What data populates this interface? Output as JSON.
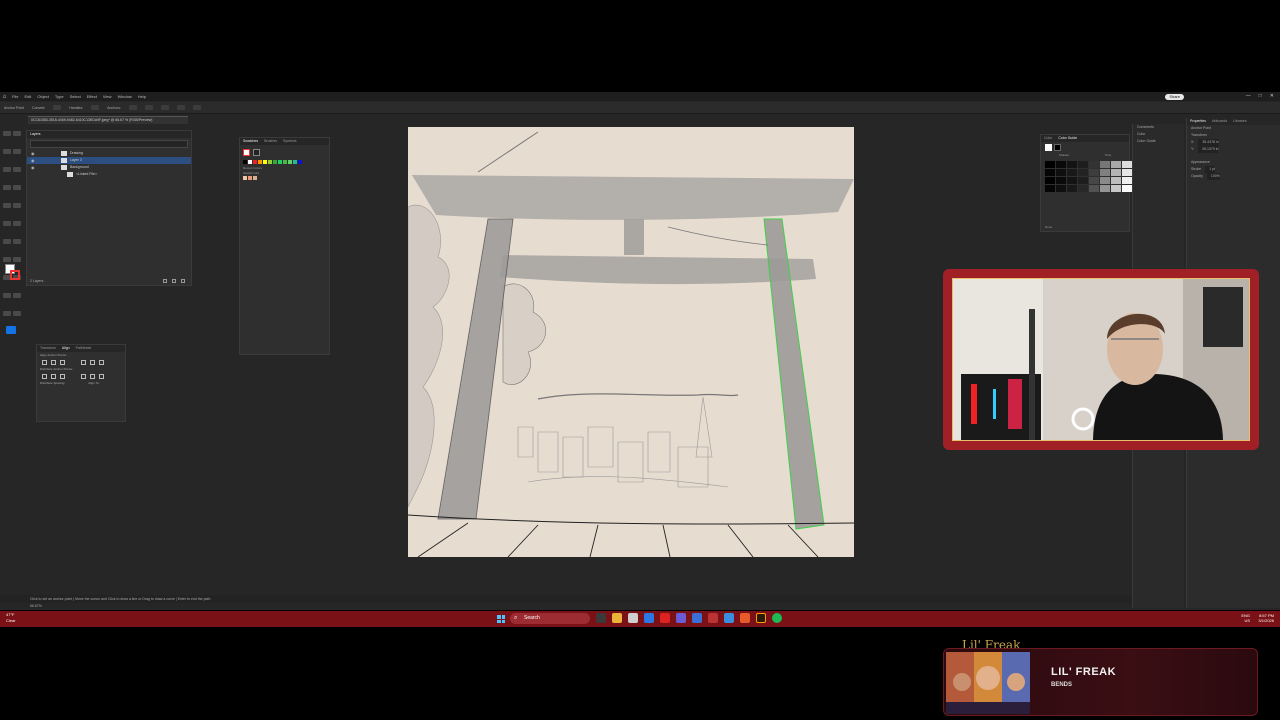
{
  "app": {
    "menu": [
      "File",
      "Edit",
      "Object",
      "Type",
      "Select",
      "Effect",
      "View",
      "Window",
      "Help"
    ],
    "share_label": "Share",
    "control_bar": [
      "Anchor Point",
      "Convert:",
      "Handles:",
      "Anchors:"
    ],
    "doc_tab": "0CC61083-3518-4459-9482-6410C13EDA9F.jpeg* @ 66.67 % (RGB/Preview)"
  },
  "layers_panel": {
    "tabs": [
      "Layers"
    ],
    "rows": [
      {
        "name": "Drawing",
        "selected": false
      },
      {
        "name": "Layer 3",
        "selected": true
      },
      {
        "name": "Background",
        "selected": false
      },
      {
        "name": "<Linked File>",
        "selected": false
      }
    ],
    "footer": "2 Layers"
  },
  "swatches_panel": {
    "tabs": [
      "Swatches",
      "Brushes",
      "Symbols"
    ],
    "recent_label": "Recent Colors",
    "library_label": "Swatch Libs"
  },
  "align_panel": {
    "tabs": [
      "Transform",
      "Align",
      "Pathfinder"
    ],
    "labels": [
      "Align Anchor Points:",
      "Distribute Anchor Points:",
      "Distribute Spacing:",
      "Align To:"
    ]
  },
  "color_panel": {
    "tabs": [
      "Color",
      "Color Guide"
    ],
    "sub_labels": [
      "Shades",
      "Tints"
    ],
    "footer": "None"
  },
  "comments_panel": {
    "items": [
      "Comments",
      "Color",
      "Color Guide"
    ]
  },
  "properties_panel": {
    "tabs": [
      "Properties",
      "Artboards",
      "Libraries"
    ],
    "labels": [
      "Anchor Point",
      "Transform",
      "X:",
      "Y:",
      "Appearance",
      "Stroke",
      "Opacity"
    ],
    "values": [
      "35.4378 in",
      "26.1379 in",
      "1 pt",
      "100%"
    ]
  },
  "status_bar": {
    "text": "Click to set an anchor point | Move the cursor and Click to draw a line or Drag to draw a curve | Enter to end the path",
    "zoom": "66.67%"
  },
  "taskbar": {
    "weather_temp": "47°F",
    "weather_desc": "Clear",
    "search_placeholder": "Search",
    "lang": "ENG",
    "region": "US",
    "time": "8:57 PM",
    "date": "3/1/2026"
  },
  "now_playing": {
    "header": "Lil' Freak",
    "title": "LIL' FREAK",
    "artist": "BENDS"
  },
  "colors": {
    "taskbar": "#7a1116",
    "webcam_frame": "#a02025",
    "artboard": "#e7dcd0",
    "accent_blue": "#1473e6"
  }
}
